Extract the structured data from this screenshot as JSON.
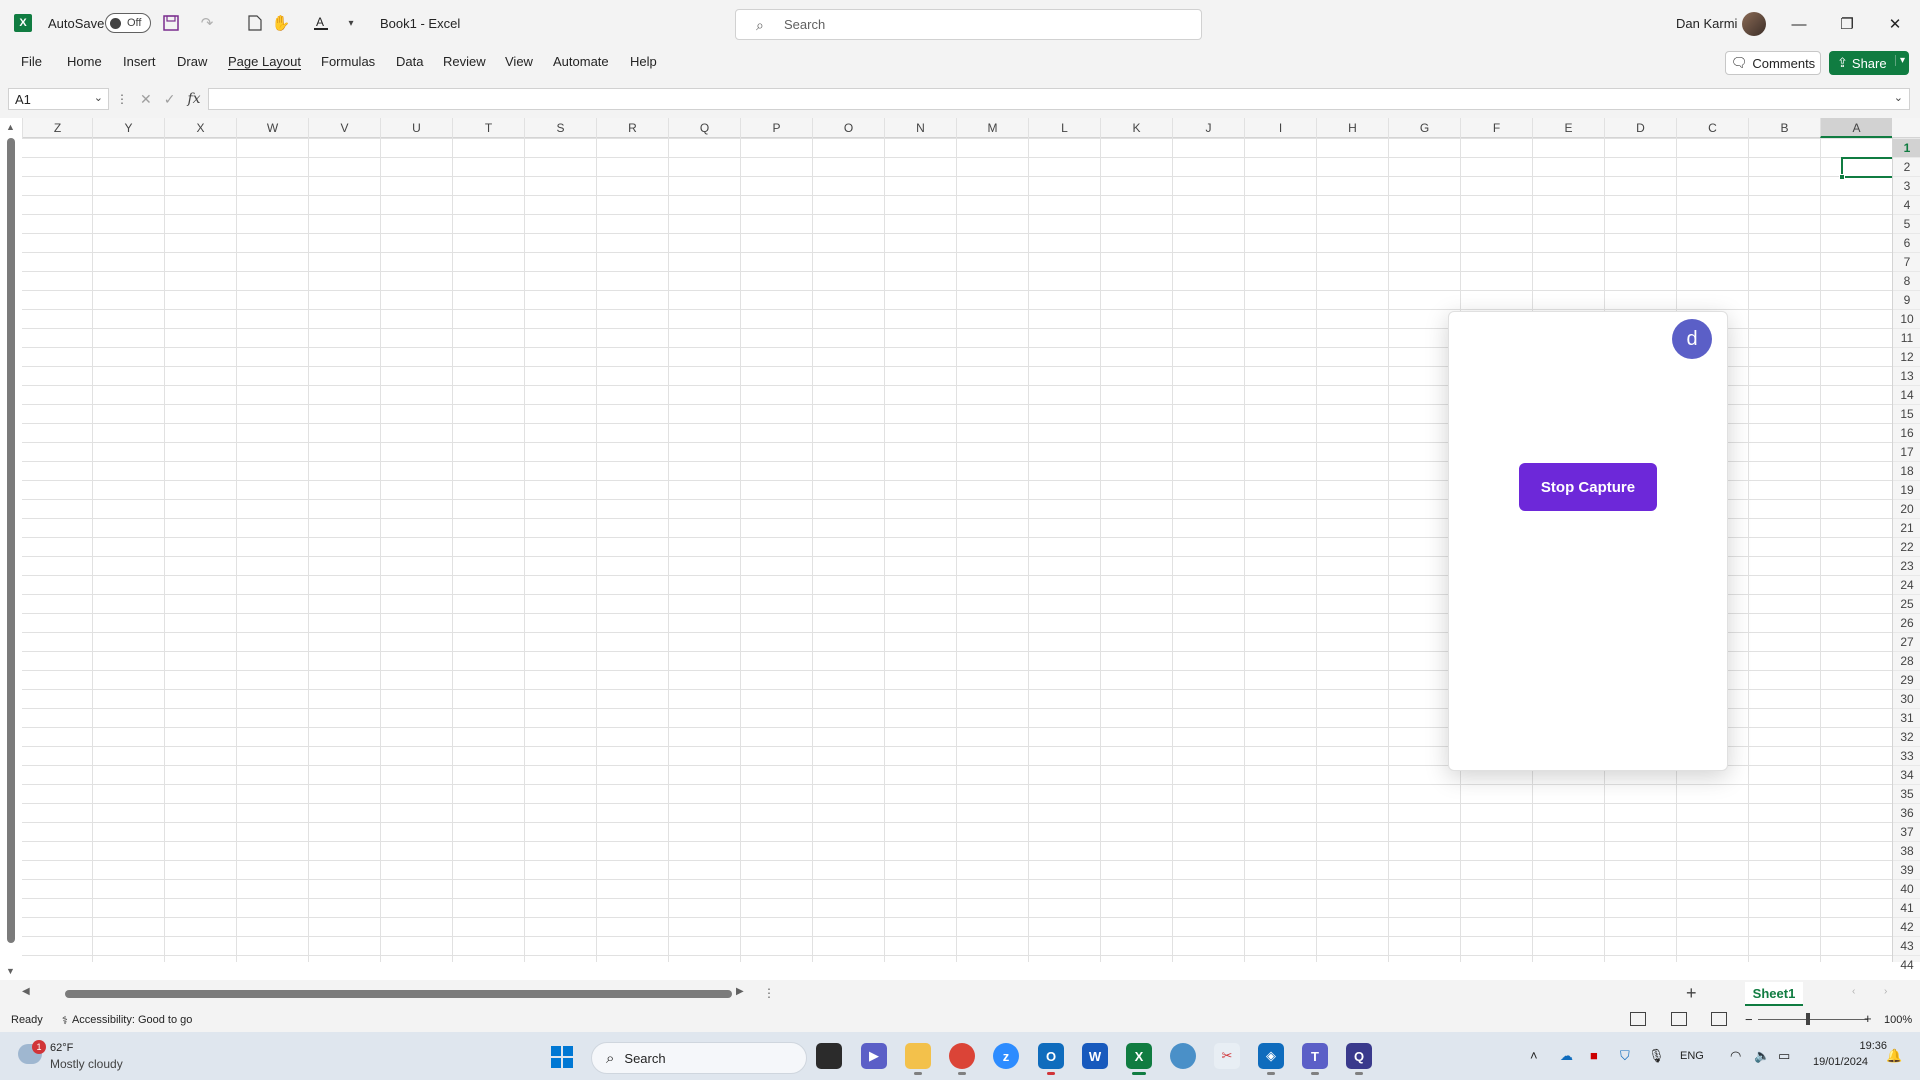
{
  "titlebar": {
    "logo_letter": "X",
    "autosave_label": "AutoSave",
    "autosave_state": "Off",
    "doc_title": "Book1 - Excel",
    "search_placeholder": "Search",
    "user_name": "Dan Karmi",
    "icons": [
      "save-icon",
      "redo-icon",
      "new-file-icon",
      "touch-mode-icon",
      "font-color-icon",
      "customize-qat-icon"
    ]
  },
  "ribbon": {
    "tabs": [
      "File",
      "Home",
      "Insert",
      "Draw",
      "Page Layout",
      "Formulas",
      "Data",
      "Review",
      "View",
      "Automate",
      "Help"
    ],
    "comments_label": "Comments",
    "share_label": "Share"
  },
  "formula_bar": {
    "name_box": "A1",
    "fx_label": "fx",
    "formula": ""
  },
  "grid": {
    "columns": [
      "Z",
      "Y",
      "X",
      "W",
      "V",
      "U",
      "T",
      "S",
      "R",
      "Q",
      "P",
      "O",
      "N",
      "M",
      "L",
      "K",
      "J",
      "I",
      "H",
      "G",
      "F",
      "E",
      "D",
      "C",
      "B",
      "A"
    ],
    "rows": [
      "1",
      "2",
      "3",
      "4",
      "5",
      "6",
      "7",
      "8",
      "9",
      "10",
      "11",
      "12",
      "13",
      "14",
      "15",
      "16",
      "17",
      "18",
      "19",
      "20",
      "21",
      "22",
      "23",
      "24",
      "25",
      "26",
      "27",
      "28",
      "29",
      "30",
      "31",
      "32",
      "33",
      "34",
      "35",
      "36",
      "37",
      "38",
      "39",
      "40",
      "41",
      "42",
      "43",
      "44"
    ],
    "active_cell": "A1"
  },
  "sheets": {
    "tabs": [
      "Sheet1"
    ],
    "active": "Sheet1"
  },
  "status": {
    "ready": "Ready",
    "accessibility": "Accessibility: Good to go",
    "zoom": "100%"
  },
  "popup": {
    "avatar_letter": "d",
    "button_label": "Stop Capture",
    "button_color": "#6d28d9"
  },
  "taskbar": {
    "weather_badge": "1",
    "weather_temp": "62°F",
    "weather_condition": "Mostly cloudy",
    "search_label": "Search",
    "apps": [
      "file-manager-icon",
      "teams-meet-icon",
      "file-explorer-icon",
      "chrome-icon",
      "zoom-icon",
      "outlook-icon",
      "word-icon",
      "excel-icon",
      "remote-app-icon",
      "snipping-tool-icon",
      "security-app-icon",
      "teams-icon",
      "capture-app-icon"
    ],
    "language": "ENG",
    "time": "19:36",
    "date": "19/01/2024"
  },
  "colors": {
    "excel_green": "#107c41",
    "accent_purple": "#6d28d9",
    "avatar_blue": "#5b5fc7"
  }
}
